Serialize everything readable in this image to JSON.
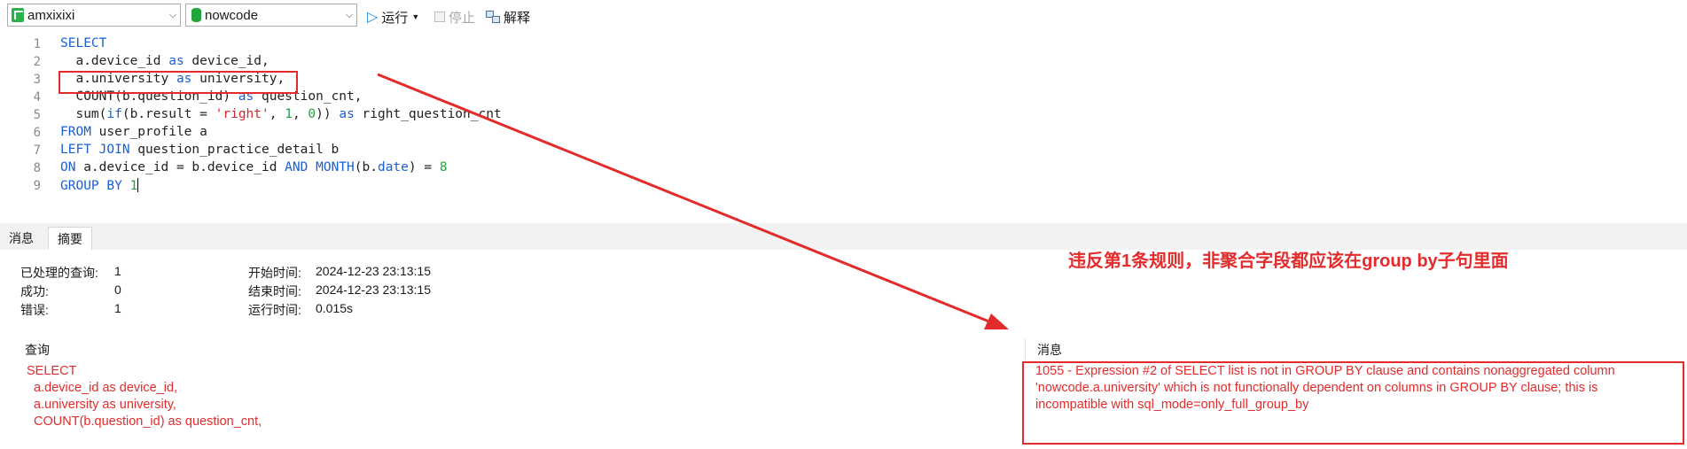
{
  "toolbar": {
    "connection": "amxixixi",
    "database": "nowcode",
    "run_label": "运行",
    "stop_label": "停止",
    "explain_label": "解释"
  },
  "editor": {
    "line_numbers": [
      "1",
      "2",
      "3",
      "4",
      "5",
      "6",
      "7",
      "8",
      "9"
    ],
    "lines": [
      [
        "SELECT"
      ],
      [
        "  a.device_id ",
        "as",
        " device_id,"
      ],
      [
        "  a.university ",
        "as",
        " university,"
      ],
      [
        "  COUNT(b.question_id) ",
        "as",
        " question_cnt,"
      ],
      [
        "  sum(",
        "if",
        "(b.result = ",
        "'right'",
        ", ",
        "1",
        ", ",
        "0",
        ")) ",
        "as",
        " right_question_cnt"
      ],
      [
        "FROM",
        " user_profile a"
      ],
      [
        "LEFT JOIN",
        " question_practice_detail b"
      ],
      [
        "ON",
        " a.device_id = b.device_id ",
        "AND",
        " ",
        "MONTH",
        "(b.",
        "date",
        ") = ",
        "8"
      ],
      [
        "GROUP BY",
        " ",
        "1"
      ]
    ]
  },
  "tabs": [
    {
      "label": "消息",
      "active": false
    },
    {
      "label": "摘要",
      "active": true
    }
  ],
  "summary": {
    "processed_label": "已处理的查询:",
    "processed_value": "1",
    "success_label": "成功:",
    "success_value": "0",
    "error_label": "错误:",
    "error_value": "1",
    "start_label": "开始时间:",
    "start_value": "2024-12-23 23:13:15",
    "end_label": "结束时间:",
    "end_value": "2024-12-23 23:13:15",
    "runtime_label": "运行时间:",
    "runtime_value": "0.015s"
  },
  "annotation": "违反第1条规则，非聚合字段都应该在group by子句里面",
  "result_grid": {
    "headers": [
      "查询",
      "消息"
    ],
    "query_lines": [
      "SELECT",
      "  a.device_id as device_id,",
      "  a.university as university,",
      "  COUNT(b.question_id) as question_cnt,"
    ],
    "message_lines": [
      "1055 - Expression #2 of SELECT list is not in GROUP BY clause and contains nonaggregated column",
      "'nowcode.a.university' which is not functionally dependent on columns in GROUP BY clause; this is",
      "incompatible with sql_mode=only_full_group_by"
    ]
  },
  "colors": {
    "keyword": "#1a5fd6",
    "string": "#d7262c",
    "number": "#1fa63a",
    "annotation": "#e42b2b"
  }
}
